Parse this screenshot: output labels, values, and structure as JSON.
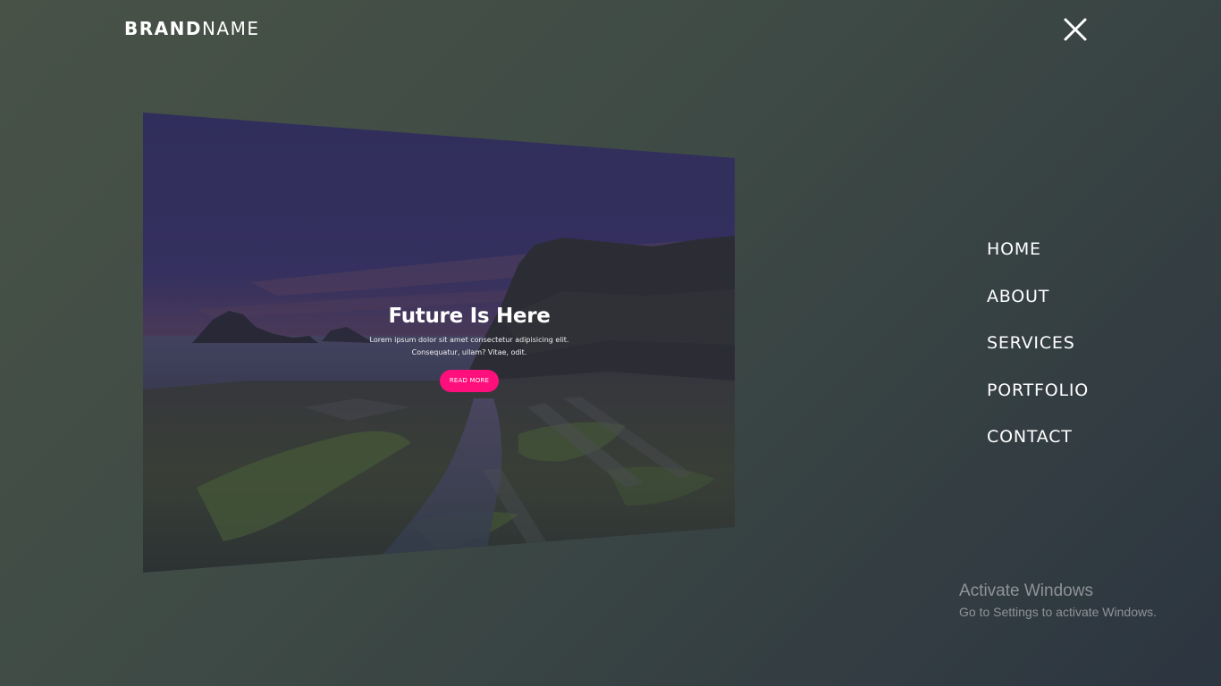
{
  "header": {
    "brand_bold": "BRAND",
    "brand_light": "NAME",
    "close_icon": "close-icon"
  },
  "hero": {
    "title": "Future Is Here",
    "text_line1": "Lorem ipsum dolor sit amet consectetur adipisicing elit.",
    "text_line2": "Consequatur, ullam? Vitae, odit.",
    "button_label": "READ MORE",
    "button_color": "#ff0f7b",
    "image_subject": "rocky-coast-at-dusk"
  },
  "nav": {
    "items": [
      {
        "label": "HOME"
      },
      {
        "label": "ABOUT"
      },
      {
        "label": "SERVICES"
      },
      {
        "label": "PORTFOLIO"
      },
      {
        "label": "CONTACT"
      }
    ]
  },
  "watermark": {
    "title": "Activate Windows",
    "subtitle": "Go to Settings to activate Windows."
  },
  "colors": {
    "background_start": "#485247",
    "background_end": "#2c3540",
    "accent": "#ff0f7b"
  }
}
